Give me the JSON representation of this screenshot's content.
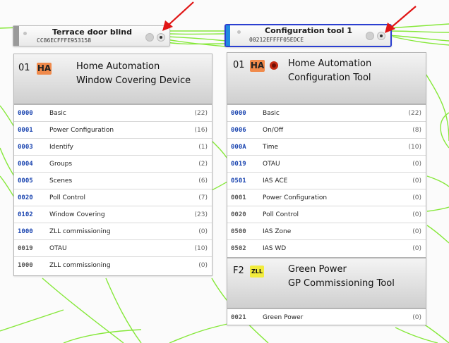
{
  "nodes": {
    "terrace": {
      "name": "Terrace door blind",
      "mac": "CC86ECFFFE953158",
      "endpoint": "01",
      "profile_badge": "HA",
      "title_line1": "Home Automation",
      "title_line2": "Window Covering Device",
      "clusters": [
        {
          "id": "0000",
          "name": "Basic",
          "count": "(22)",
          "side": "server"
        },
        {
          "id": "0001",
          "name": "Power Configuration",
          "count": "(16)",
          "side": "server"
        },
        {
          "id": "0003",
          "name": "Identify",
          "count": "(1)",
          "side": "server"
        },
        {
          "id": "0004",
          "name": "Groups",
          "count": "(2)",
          "side": "server"
        },
        {
          "id": "0005",
          "name": "Scenes",
          "count": "(6)",
          "side": "server"
        },
        {
          "id": "0020",
          "name": "Poll Control",
          "count": "(7)",
          "side": "server"
        },
        {
          "id": "0102",
          "name": "Window Covering",
          "count": "(23)",
          "side": "server"
        },
        {
          "id": "1000",
          "name": "ZLL commissioning",
          "count": "(0)",
          "side": "server"
        },
        {
          "id": "0019",
          "name": "OTAU",
          "count": "(10)",
          "side": "client"
        },
        {
          "id": "1000",
          "name": "ZLL commissioning",
          "count": "(0)",
          "side": "client"
        }
      ]
    },
    "config": {
      "name": "Configuration tool 1",
      "mac": "00212EFFFF05EDCE",
      "endpoint": "01",
      "profile_badge": "HA",
      "title_line1": "Home Automation",
      "title_line2": "Configuration Tool",
      "clusters": [
        {
          "id": "0000",
          "name": "Basic",
          "count": "(22)",
          "side": "server"
        },
        {
          "id": "0006",
          "name": "On/Off",
          "count": "(8)",
          "side": "server"
        },
        {
          "id": "000A",
          "name": "Time",
          "count": "(10)",
          "side": "server"
        },
        {
          "id": "0019",
          "name": "OTAU",
          "count": "(0)",
          "side": "server"
        },
        {
          "id": "0501",
          "name": "IAS ACE",
          "count": "(0)",
          "side": "server"
        },
        {
          "id": "0001",
          "name": "Power Configuration",
          "count": "(0)",
          "side": "client"
        },
        {
          "id": "0020",
          "name": "Poll Control",
          "count": "(0)",
          "side": "client"
        },
        {
          "id": "0500",
          "name": "IAS Zone",
          "count": "(0)",
          "side": "client"
        },
        {
          "id": "0502",
          "name": "IAS WD",
          "count": "(0)",
          "side": "client"
        }
      ],
      "gp_endpoint": "F2",
      "gp_badge": "ZLL",
      "gp_title_line1": "Green Power",
      "gp_title_line2": "GP Commissioning Tool",
      "gp_clusters": [
        {
          "id": "0021",
          "name": "Green Power",
          "count": "(0)",
          "side": "client"
        }
      ]
    }
  },
  "colors": {
    "server_cluster": "#1b45b0",
    "client_cluster": "#555555",
    "link_line": "#86e83a",
    "selected_border": "#2b3fd0",
    "arrow": "#e01515"
  }
}
